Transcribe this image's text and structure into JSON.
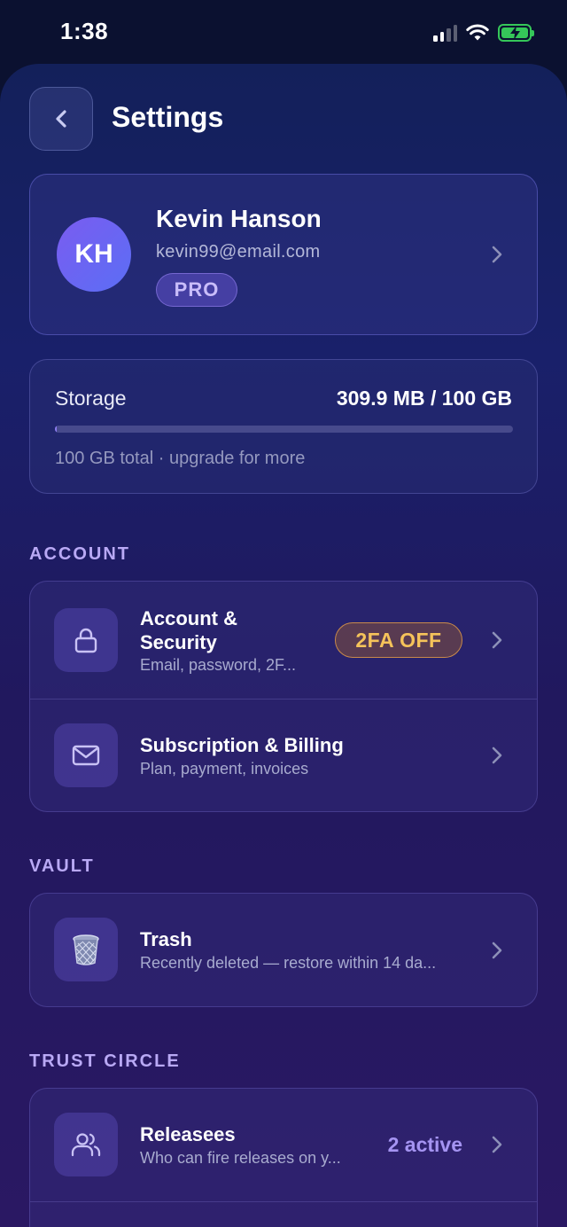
{
  "status_bar": {
    "time": "1:38"
  },
  "header": {
    "title": "Settings"
  },
  "profile": {
    "initials": "KH",
    "name": "Kevin Hanson",
    "email": "kevin99@email.com",
    "plan_badge": "PRO"
  },
  "storage": {
    "label": "Storage",
    "value": "309.9 MB / 100 GB",
    "used_fraction": 0.003,
    "note": "100 GB total · upgrade for more"
  },
  "sections": {
    "account": {
      "title": "ACCOUNT",
      "items": [
        {
          "title_line1": "Account &",
          "title_line2": "Security",
          "subtitle": "Email, password, 2F...",
          "badge": "2FA OFF",
          "icon": "lock-icon"
        },
        {
          "title": "Subscription & Billing",
          "subtitle": "Plan, payment, invoices",
          "icon": "mail-icon"
        }
      ]
    },
    "vault": {
      "title": "VAULT",
      "items": [
        {
          "title": "Trash",
          "subtitle": "Recently deleted — restore within 14 da...",
          "icon": "trash-icon"
        }
      ]
    },
    "trust_circle": {
      "title": "TRUST CIRCLE",
      "items": [
        {
          "title": "Releasees",
          "subtitle": "Who can fire releases on y...",
          "value": "2 active",
          "icon": "users-icon"
        }
      ]
    }
  },
  "colors": {
    "accent": "#8c7cf0",
    "section_title": "#b9a9f5",
    "warning_badge_text": "#f5c35a",
    "battery": "#35c759"
  }
}
